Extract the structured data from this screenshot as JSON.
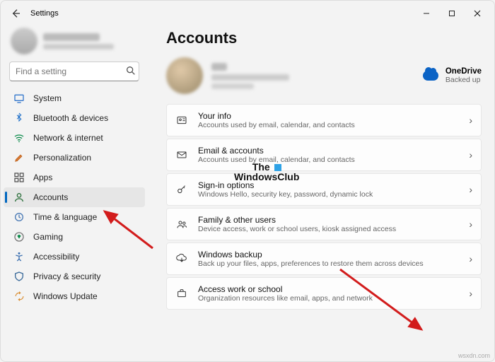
{
  "window": {
    "title": "Settings"
  },
  "search": {
    "placeholder": "Find a setting"
  },
  "sidebar": {
    "items": [
      {
        "label": "System"
      },
      {
        "label": "Bluetooth & devices"
      },
      {
        "label": "Network & internet"
      },
      {
        "label": "Personalization"
      },
      {
        "label": "Apps"
      },
      {
        "label": "Accounts"
      },
      {
        "label": "Time & language"
      },
      {
        "label": "Gaming"
      },
      {
        "label": "Accessibility"
      },
      {
        "label": "Privacy & security"
      },
      {
        "label": "Windows Update"
      }
    ]
  },
  "main": {
    "heading": "Accounts",
    "onedrive": {
      "title": "OneDrive",
      "sub": "Backed up"
    },
    "cards": [
      {
        "title": "Your info",
        "sub": "Accounts used by email, calendar, and contacts"
      },
      {
        "title": "Email & accounts",
        "sub": "Accounts used by email, calendar, and contacts"
      },
      {
        "title": "Sign-in options",
        "sub": "Windows Hello, security key, password, dynamic lock"
      },
      {
        "title": "Family & other users",
        "sub": "Device access, work or school users, kiosk assigned access"
      },
      {
        "title": "Windows backup",
        "sub": "Back up your files, apps, preferences to restore them across devices"
      },
      {
        "title": "Access work or school",
        "sub": "Organization resources like email, apps, and network"
      }
    ]
  },
  "watermark": {
    "line1": "The",
    "line2": "WindowsClub"
  },
  "credit": "wsxdn.com"
}
